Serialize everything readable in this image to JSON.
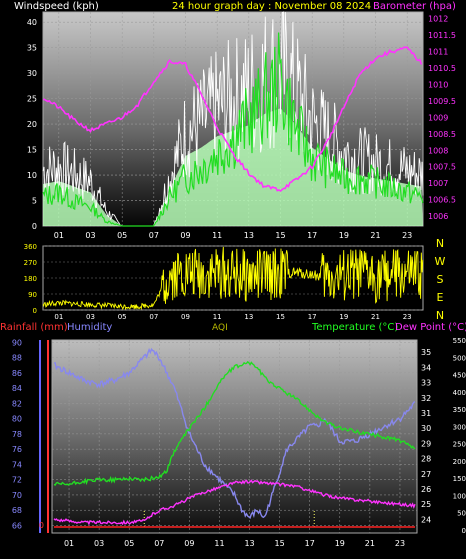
{
  "panel_top": {
    "title_left": "Windspeed (kph)",
    "title_center": "24 hour graph day : November 08 2024",
    "title_right": "Barometer (hpa)"
  },
  "panel_mid": {
    "compass": [
      "N",
      "W",
      "S",
      "E",
      "N"
    ]
  },
  "panel_bottom": {
    "label_rainfall": "Rainfall (mm)",
    "label_humidity": "Humidity",
    "label_aqi": "AQI",
    "label_temperature": "Temperature (°C)",
    "label_dewpoint": "Dew Point (°C)"
  },
  "colors": {
    "wind": "#ffffff",
    "gust_fill": "#b8ffb8",
    "wind_line": "#22dd22",
    "barometer": "#ff33ff",
    "direction": "#ffff00",
    "humidity": "#8888ee",
    "temperature": "#22dd22",
    "dewpoint": "#ff33ff",
    "rainfall": "#ff2222",
    "aqi_axis": "#ffaa00"
  },
  "chart_data": [
    {
      "type": "line",
      "x_ticks": [
        "01",
        "03",
        "05",
        "07",
        "09",
        "11",
        "13",
        "15",
        "17",
        "19",
        "21",
        "23"
      ],
      "y_left_ticks": [
        "0",
        "5",
        "10",
        "15",
        "20",
        "25",
        "30",
        "35",
        "40"
      ],
      "y_left_range": [
        0,
        42
      ],
      "y_right_ticks": [
        "1006",
        "1006.5",
        "1007",
        "1007.5",
        "1008",
        "1008.5",
        "1009",
        "1009.5",
        "1010",
        "1010.5",
        "1011",
        "1011.5",
        "1012"
      ],
      "y_right_range": [
        1005.7,
        1012.2
      ],
      "series": [
        {
          "role": "windspeed",
          "axis": "left",
          "x": [
            0,
            1,
            2,
            3,
            4,
            5,
            6,
            7,
            8,
            9,
            10,
            11,
            12,
            13,
            14,
            15,
            16,
            17,
            18,
            19,
            20,
            21,
            22,
            23,
            24
          ],
          "values": [
            6,
            7,
            5,
            4,
            1,
            0,
            0,
            0,
            6,
            10,
            12,
            15,
            18,
            22,
            26,
            30,
            20,
            14,
            12,
            10,
            10,
            9,
            8,
            7,
            6
          ]
        },
        {
          "role": "gust",
          "axis": "left",
          "x": [
            0,
            1,
            2,
            3,
            4,
            5,
            6,
            7,
            8,
            9,
            10,
            11,
            12,
            13,
            14,
            15,
            16,
            17,
            18,
            19,
            20,
            21,
            22,
            23,
            24
          ],
          "values": [
            15,
            16,
            14,
            12,
            4,
            0,
            0,
            0,
            13,
            25,
            28,
            32,
            34,
            36,
            40,
            42,
            36,
            28,
            24,
            20,
            18,
            17,
            16,
            15,
            14
          ]
        },
        {
          "role": "barometer",
          "axis": "right",
          "x": [
            0,
            1,
            2,
            3,
            4,
            5,
            6,
            7,
            8,
            9,
            10,
            11,
            12,
            13,
            14,
            15,
            16,
            17,
            18,
            19,
            20,
            21,
            22,
            23,
            24
          ],
          "values": [
            1009.6,
            1009.3,
            1008.9,
            1008.6,
            1008.8,
            1009.0,
            1009.4,
            1010.1,
            1010.7,
            1010.6,
            1009.7,
            1008.7,
            1007.9,
            1007.3,
            1006.9,
            1006.8,
            1007.1,
            1007.5,
            1008.3,
            1009.3,
            1010.3,
            1010.8,
            1011.0,
            1011.1,
            1010.6
          ]
        }
      ]
    },
    {
      "type": "scatter",
      "x_ticks": [
        "01",
        "03",
        "05",
        "07",
        "09",
        "11",
        "13",
        "15",
        "17",
        "19",
        "21",
        "23"
      ],
      "y_ticks": [
        "0",
        "90",
        "180",
        "270",
        "360"
      ],
      "y_range": [
        0,
        360
      ],
      "series": [
        {
          "role": "wind_direction",
          "x": [
            0,
            1,
            2,
            3,
            4,
            5,
            6,
            7,
            7.5,
            8,
            9,
            10,
            11,
            12,
            13,
            14,
            15,
            16,
            17,
            18,
            19,
            20,
            21,
            22,
            23,
            24
          ],
          "values": [
            30,
            40,
            35,
            30,
            25,
            20,
            20,
            30,
            120,
            200,
            210,
            200,
            210,
            200,
            190,
            200,
            205,
            210,
            200,
            180,
            190,
            200,
            190,
            200,
            190,
            200
          ]
        }
      ]
    },
    {
      "type": "line",
      "x_ticks": [
        "01",
        "03",
        "05",
        "07",
        "09",
        "11",
        "13",
        "15",
        "17",
        "19",
        "21",
        "23"
      ],
      "humidity_ticks": [
        "66",
        "68",
        "70",
        "72",
        "74",
        "76",
        "78",
        "80",
        "82",
        "84",
        "86",
        "88",
        "90"
      ],
      "humidity_range": [
        65.8,
        90.3
      ],
      "aqi_ticks": [
        "0",
        "50",
        "100",
        "150",
        "200",
        "250",
        "300",
        "350",
        "400",
        "450",
        "500",
        "550"
      ],
      "temp_ticks": [
        "24",
        "25",
        "26",
        "27",
        "28",
        "29",
        "30",
        "31",
        "32",
        "33",
        "34",
        "35"
      ],
      "temp_range": [
        23.5,
        35.8
      ],
      "rain_ticks": [
        "0"
      ],
      "series": [
        {
          "role": "humidity",
          "axis": "humidity",
          "x": [
            0,
            0.5,
            1,
            2,
            3,
            4,
            5,
            6,
            6.5,
            7,
            7.5,
            8,
            8.5,
            9,
            9.5,
            10,
            10.5,
            11,
            11.5,
            12,
            12.5,
            13,
            13.5,
            14,
            14.5,
            15,
            15.5,
            16,
            16.5,
            17,
            17.5,
            18,
            19,
            20,
            21,
            22,
            23,
            24
          ],
          "values": [
            87,
            86.5,
            86,
            85,
            84.5,
            85,
            86,
            88,
            89,
            88,
            86,
            84,
            81,
            78,
            76,
            74,
            73,
            72,
            71,
            70,
            68,
            67,
            68,
            67,
            70,
            73,
            76,
            77,
            78,
            79,
            79,
            80,
            77,
            77,
            78,
            79,
            80,
            82
          ]
        },
        {
          "role": "temperature",
          "axis": "temp",
          "x": [
            0,
            1,
            2,
            3,
            4,
            5,
            6,
            7,
            7.5,
            8,
            9,
            10,
            11,
            11.5,
            12,
            12.5,
            13,
            13.5,
            14,
            15,
            16,
            17,
            18,
            19,
            20,
            21,
            22,
            23,
            24
          ],
          "values": [
            26.3,
            26.3,
            26.5,
            26.6,
            26.6,
            26.7,
            26.6,
            26.8,
            27.2,
            28.5,
            30,
            31.3,
            33,
            33.6,
            34,
            34.2,
            34.3,
            34,
            33.3,
            32.6,
            32,
            31.2,
            30.4,
            30,
            29.8,
            29.6,
            29.4,
            29.2,
            28.6
          ]
        },
        {
          "role": "dewpoint",
          "axis": "temp",
          "x": [
            0,
            1,
            2,
            3,
            4,
            5,
            6,
            6.5,
            7,
            8,
            9,
            10,
            11,
            12,
            13,
            14,
            15,
            16,
            17,
            18,
            19,
            20,
            21,
            22,
            23,
            24
          ],
          "values": [
            24,
            23.9,
            23.8,
            23.8,
            23.8,
            23.8,
            23.9,
            24.3,
            24.6,
            24.9,
            25.4,
            25.8,
            26.1,
            26.4,
            26.5,
            26.4,
            26.3,
            26.2,
            25.9,
            25.6,
            25.4,
            25.3,
            25.2,
            25.1,
            25,
            24.9
          ]
        },
        {
          "role": "rainfall",
          "axis": "rain",
          "x": [
            0,
            24
          ],
          "values": [
            0,
            0
          ]
        }
      ]
    }
  ]
}
